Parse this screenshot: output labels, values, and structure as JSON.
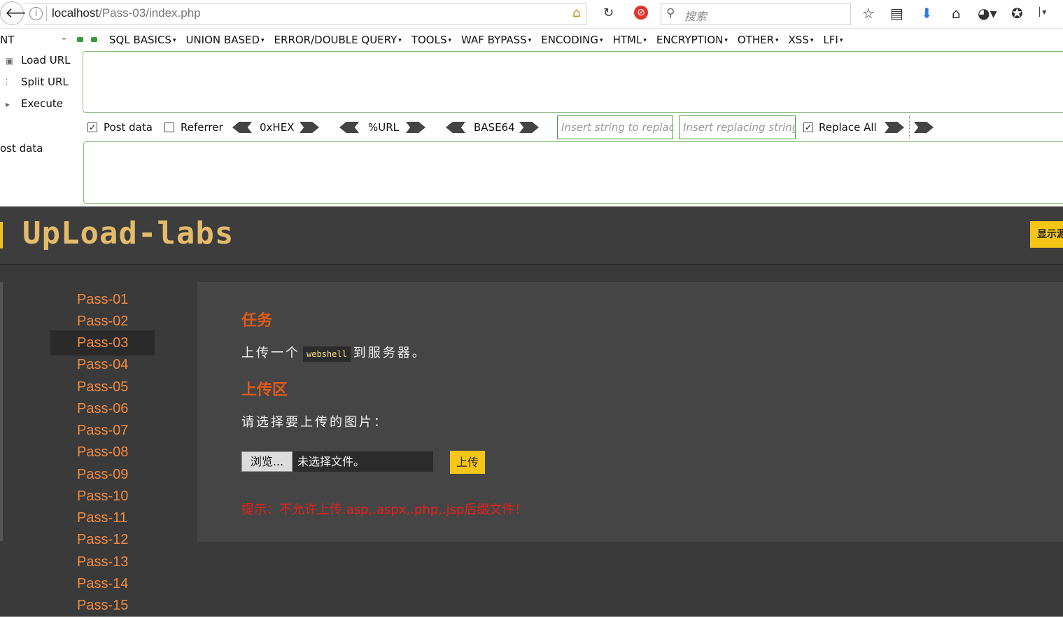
{
  "browser": {
    "url_host": "localhost",
    "url_path": "/Pass-03/index.php",
    "search_placeholder": "搜索"
  },
  "hackbar": {
    "selector_value": "NT",
    "menu": [
      "SQL BASICS",
      "UNION BASED",
      "ERROR/DOUBLE QUERY",
      "TOOLS",
      "WAF BYPASS",
      "ENCODING",
      "HTML",
      "ENCRYPTION",
      "OTHER",
      "XSS",
      "LFI"
    ],
    "actions": {
      "load": "Load URL",
      "split": "Split URL",
      "execute": "Execute"
    },
    "url_value": "",
    "post_data_checked": true,
    "post_data_label": "Post data",
    "referrer_checked": false,
    "referrer_label": "Referrer",
    "encoders": {
      "hex": "0xHEX",
      "url": "%URL",
      "base64": "BASE64"
    },
    "replace_find_placeholder": "Insert string to replace",
    "replace_with_placeholder": "Insert replacing string",
    "replace_all_checked": true,
    "replace_all_label": "Replace All",
    "post_area_label": "ost data",
    "post_value": ""
  },
  "page": {
    "logo": "UpLoad-labs",
    "show_source_label": "显示源码",
    "nav": [
      "Pass-01",
      "Pass-02",
      "Pass-03",
      "Pass-04",
      "Pass-05",
      "Pass-06",
      "Pass-07",
      "Pass-08",
      "Pass-09",
      "Pass-10",
      "Pass-11",
      "Pass-12",
      "Pass-13",
      "Pass-14",
      "Pass-15"
    ],
    "active_nav": "Pass-03",
    "task_title": "任务",
    "task_prefix": "上传一个",
    "task_code": "webshell",
    "task_suffix": "到服务器。",
    "upload_title": "上传区",
    "upload_prompt": "请选择要上传的图片：",
    "browse_label": "浏览...",
    "file_status": "未选择文件。",
    "upload_button": "上传",
    "hint": "提示：不允许上传.asp,.aspx,.php,.jsp后缀文件！",
    "colors": {
      "accent": "#f5c518",
      "nav_link": "#f08a40",
      "heading": "#e05a1a",
      "hint": "#e8201a"
    }
  }
}
